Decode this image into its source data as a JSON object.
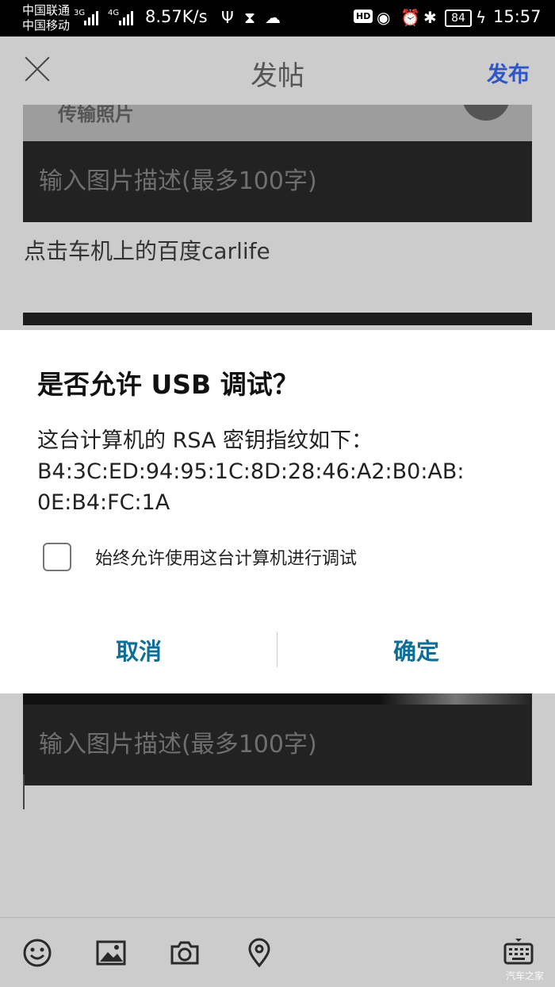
{
  "status_bar": {
    "carrier_1": "中国联通",
    "carrier_2": "中国移动",
    "net_1": "3G",
    "net_2": "4G",
    "speed": "8.57K/s",
    "hd": "HD",
    "battery": "84",
    "time": "15:57"
  },
  "header": {
    "title": "发帖",
    "publish_label": "发布"
  },
  "post": {
    "photo1_text": "传输照片",
    "description_placeholder": "输入图片描述(最多100字)",
    "caption": "点击车机上的百度carlife",
    "description_placeholder_2": "输入图片描述(最多100字)"
  },
  "dialog": {
    "title": "是否允许 USB 调试？",
    "message_line1": "这台计算机的 RSA 密钥指纹如下：",
    "message_line2": "B4:3C:ED:94:95:1C:8D:28:46:A2:B0:AB:",
    "message_line3": "0E:B4:FC:1A",
    "always_allow_label": "始终允许使用这台计算机进行调试",
    "always_allow_checked": false,
    "cancel_label": "取消",
    "ok_label": "确定"
  },
  "toolbar": {
    "icons": [
      "emoji-icon",
      "image-icon",
      "camera-icon",
      "location-icon",
      "keyboard-icon"
    ]
  },
  "watermark": "汽车之家",
  "colors": {
    "accent_blue": "#2f56c8",
    "dialog_button": "#0f6e96"
  }
}
